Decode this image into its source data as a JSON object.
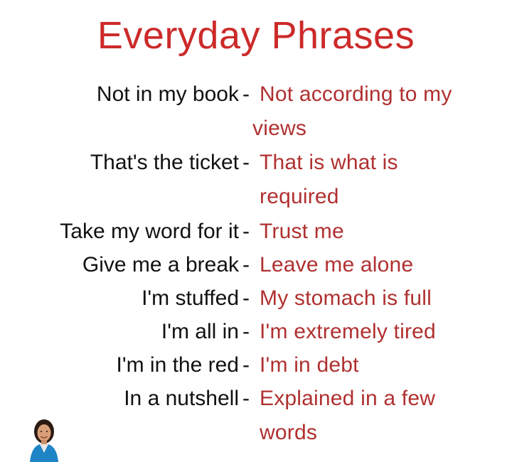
{
  "title": "Everyday Phrases",
  "phrases": [
    {
      "phrase": "Not in my book",
      "meaning_line1": "Not according to my",
      "meaning_line2": "views"
    },
    {
      "phrase": "That's the ticket",
      "meaning_line1": "That is what is",
      "meaning_line2": "required"
    },
    {
      "phrase": "Take my word for it",
      "meaning_line1": "Trust me"
    },
    {
      "phrase": "Give me a break",
      "meaning_line1": "Leave me alone"
    },
    {
      "phrase": "I'm stuffed",
      "meaning_line1": "My stomach is full"
    },
    {
      "phrase": "I'm all in",
      "meaning_line1": "I'm extremely tired"
    },
    {
      "phrase": "I'm in the red",
      "meaning_line1": "I'm in debt"
    },
    {
      "phrase": "In a nutshell",
      "meaning_line1": "Explained in a few",
      "meaning_line2": "words"
    }
  ],
  "separator": "-",
  "colors": {
    "title": "#cc2a2a",
    "meaning": "#b03030",
    "phrase": "#111111"
  }
}
